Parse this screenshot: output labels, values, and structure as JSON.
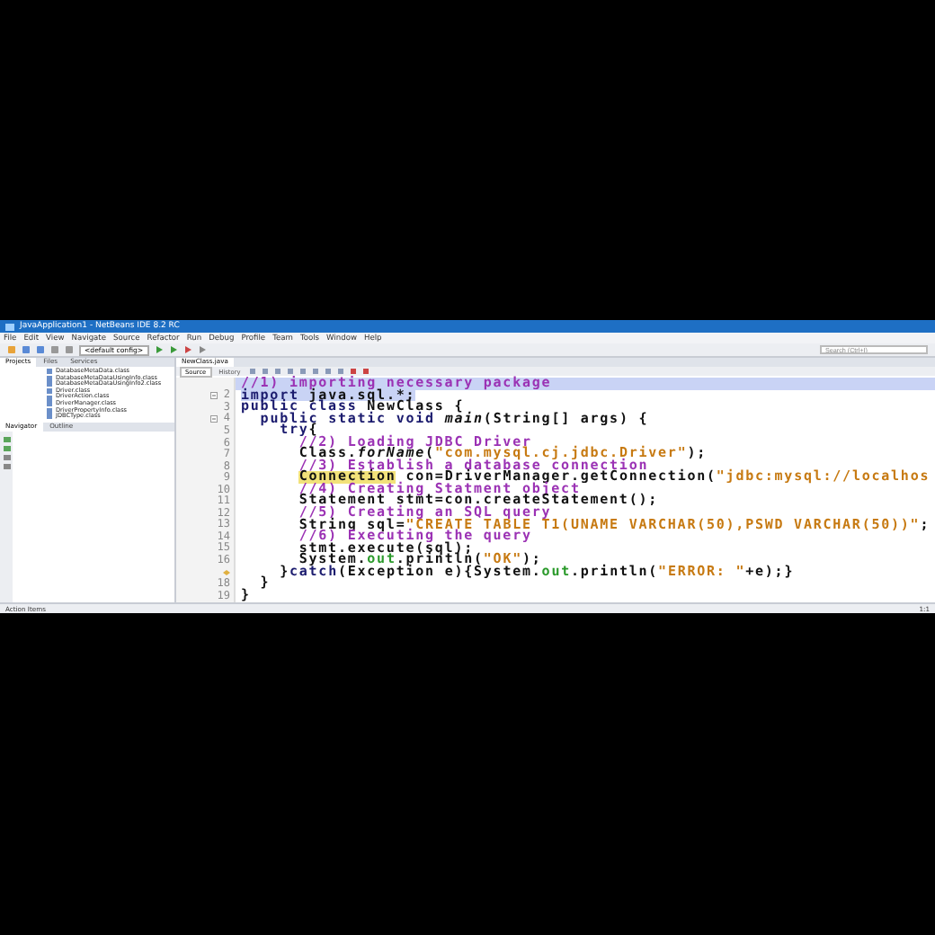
{
  "window": {
    "title": "JavaApplication1 - NetBeans IDE 8.2 RC"
  },
  "menu": [
    "File",
    "Edit",
    "View",
    "Navigate",
    "Source",
    "Refactor",
    "Run",
    "Debug",
    "Profile",
    "Team",
    "Tools",
    "Window",
    "Help"
  ],
  "toolbar": {
    "config": "<default config>",
    "search": {
      "placeholder": "Search (Ctrl+I)"
    }
  },
  "projects_panel": {
    "tabs": [
      {
        "label": "Projects",
        "selected": true
      },
      {
        "label": "Files",
        "selected": false
      },
      {
        "label": "Services",
        "selected": false
      }
    ],
    "files": [
      "DatabaseMetaData.class",
      "DatabaseMetaDataUsingInfo.class",
      "DatabaseMetaDataUsingInfo2.class",
      "Driver.class",
      "DriverAction.class",
      "DriverManager.class",
      "DriverPropertyInfo.class",
      "JDBCType.class"
    ]
  },
  "navigator_panel": {
    "tabs": [
      {
        "label": "Navigator",
        "selected": true
      },
      {
        "label": "Outline",
        "selected": false
      }
    ]
  },
  "editor": {
    "tabs": [
      {
        "label": "NewClass.java",
        "selected": true
      }
    ],
    "view_tabs": [
      {
        "label": "Source",
        "selected": true
      },
      {
        "label": "History",
        "selected": false
      }
    ],
    "lines": [
      {
        "selected": true,
        "fold": false,
        "marker": false,
        "segments": [
          {
            "kind": "comment",
            "text": "//1) importing necessary package"
          }
        ]
      },
      {
        "number": "2",
        "selected": false,
        "fold": true,
        "marker": false,
        "segments": [
          {
            "kind": "keyword",
            "text": "import",
            "selected": true
          },
          {
            "kind": "plain",
            "text": " java.sql.*;",
            "selected": true
          }
        ]
      },
      {
        "number": "3",
        "selected": false,
        "fold": false,
        "marker": false,
        "segments": [
          {
            "kind": "keyword",
            "text": "public class"
          },
          {
            "kind": "plain",
            "text": " NewClass {"
          }
        ]
      },
      {
        "number": "4",
        "selected": false,
        "fold": true,
        "marker": false,
        "segments": [
          {
            "kind": "keyword",
            "text": "  public static void"
          },
          {
            "kind": "method",
            "text": " main"
          },
          {
            "kind": "plain",
            "text": "(String[] args) {"
          }
        ]
      },
      {
        "number": "5",
        "selected": false,
        "fold": false,
        "marker": false,
        "segments": [
          {
            "kind": "keyword",
            "text": "    try"
          },
          {
            "kind": "plain",
            "text": "{"
          }
        ]
      },
      {
        "number": "6",
        "selected": false,
        "fold": false,
        "marker": false,
        "segments": [
          {
            "kind": "comment",
            "text": "      //2) Loading JDBC Driver"
          }
        ]
      },
      {
        "number": "7",
        "selected": false,
        "fold": false,
        "marker": false,
        "segments": [
          {
            "kind": "plain",
            "text": "      Class."
          },
          {
            "kind": "method",
            "text": "forName"
          },
          {
            "kind": "plain",
            "text": "("
          },
          {
            "kind": "string",
            "text": "\"com.mysql.cj.jdbc.Driver\""
          },
          {
            "kind": "plain",
            "text": ");"
          }
        ]
      },
      {
        "number": "8",
        "selected": false,
        "fold": false,
        "marker": false,
        "segments": [
          {
            "kind": "comment",
            "text": "      //3) Establish a database connection"
          }
        ]
      },
      {
        "number": "9",
        "selected": false,
        "fold": false,
        "marker": false,
        "segments": [
          {
            "kind": "highlight",
            "text": "      Connection"
          },
          {
            "kind": "plain",
            "text": " con=DriverManager.getConnection("
          },
          {
            "kind": "string",
            "text": "\"jdbc:mysql://localhos"
          }
        ]
      },
      {
        "number": "10",
        "selected": false,
        "fold": false,
        "marker": false,
        "segments": [
          {
            "kind": "comment",
            "text": "      //4) Creating Statment object"
          }
        ]
      },
      {
        "number": "11",
        "selected": false,
        "fold": false,
        "marker": false,
        "segments": [
          {
            "kind": "plain",
            "text": "      Statement stmt=con.createStatement();"
          }
        ]
      },
      {
        "number": "12",
        "selected": false,
        "fold": false,
        "marker": false,
        "segments": [
          {
            "kind": "comment",
            "text": "      //5) Creating an SQL query"
          }
        ]
      },
      {
        "number": "13",
        "selected": false,
        "fold": false,
        "marker": false,
        "segments": [
          {
            "kind": "plain",
            "text": "      String sql="
          },
          {
            "kind": "string",
            "text": "\"CREATE TABLE T1(UNAME VARCHAR(50),PSWD VARCHAR(50))\""
          },
          {
            "kind": "plain",
            "text": ";"
          }
        ]
      },
      {
        "number": "14",
        "selected": false,
        "fold": false,
        "marker": false,
        "segments": [
          {
            "kind": "comment",
            "text": "      //6) Executing the query"
          }
        ]
      },
      {
        "number": "15",
        "selected": false,
        "fold": false,
        "marker": false,
        "segments": [
          {
            "kind": "plain",
            "text": "      stmt.execute(sql);"
          }
        ]
      },
      {
        "number": "16",
        "selected": false,
        "fold": false,
        "marker": false,
        "segments": [
          {
            "kind": "plain",
            "text": "      System."
          },
          {
            "kind": "field",
            "text": "out"
          },
          {
            "kind": "plain",
            "text": ".println("
          },
          {
            "kind": "string",
            "text": "\"OK\""
          },
          {
            "kind": "plain",
            "text": ");"
          }
        ]
      },
      {
        "selected": false,
        "fold": false,
        "marker": true,
        "segments": [
          {
            "kind": "plain",
            "text": "    }"
          },
          {
            "kind": "keyword",
            "text": "catch"
          },
          {
            "kind": "plain",
            "text": "(Exception e){System."
          },
          {
            "kind": "field",
            "text": "out"
          },
          {
            "kind": "plain",
            "text": ".println("
          },
          {
            "kind": "string",
            "text": "\"ERROR: \""
          },
          {
            "kind": "plain",
            "text": "+e);}"
          }
        ]
      },
      {
        "number": "18",
        "selected": false,
        "fold": false,
        "marker": false,
        "segments": [
          {
            "kind": "plain",
            "text": "  }"
          }
        ]
      },
      {
        "number": "19",
        "selected": false,
        "fold": false,
        "marker": false,
        "segments": [
          {
            "kind": "plain",
            "text": "}"
          }
        ]
      }
    ]
  },
  "status_bar": {
    "left": "Action Items",
    "position": "1:1"
  }
}
